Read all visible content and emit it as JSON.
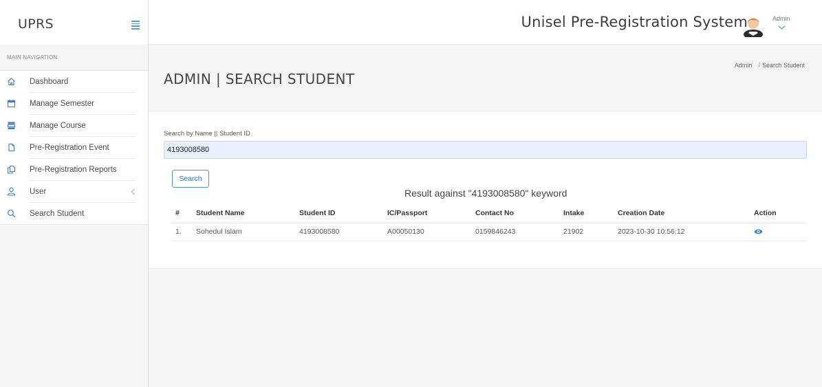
{
  "header": {
    "brand": "UPRS",
    "system_title": "Unisel Pre-Registration System",
    "user_name": "Admin"
  },
  "sidebar": {
    "section_title": "MAIN NAVIGATION",
    "items": [
      {
        "label": "Dashboard",
        "icon": "home-icon"
      },
      {
        "label": "Manage Semester",
        "icon": "calendar-icon"
      },
      {
        "label": "Manage Course",
        "icon": "server-icon"
      },
      {
        "label": "Pre-Registration Event",
        "icon": "document-icon"
      },
      {
        "label": "Pre-Registration Reports",
        "icon": "documents-icon"
      },
      {
        "label": "User",
        "icon": "user-icon"
      },
      {
        "label": "Search Student",
        "icon": "search-icon"
      }
    ]
  },
  "page": {
    "title": "ADMIN | SEARCH STUDENT",
    "breadcrumb": [
      "Admin",
      "Search Student"
    ]
  },
  "search": {
    "label": "Search by Name || Student ID",
    "value": "4193008580",
    "button": "Search",
    "result_caption": "Result against \"4193008580\" keyword"
  },
  "table": {
    "headers": [
      "#",
      "Student Name",
      "Student ID",
      "IC/Passport",
      "Contact No",
      "Intake",
      "Creation Date",
      "Action"
    ],
    "rows": [
      [
        "1.",
        "Sohedul Islam",
        "4193008580",
        "A00050130",
        "0159846243",
        "21902",
        "2023-10-30 10:56:12"
      ]
    ]
  },
  "colors": {
    "accent": "#2f7fd8",
    "input_bg": "#e8f0fd",
    "sidebar_bg": "#f5f5f5"
  }
}
